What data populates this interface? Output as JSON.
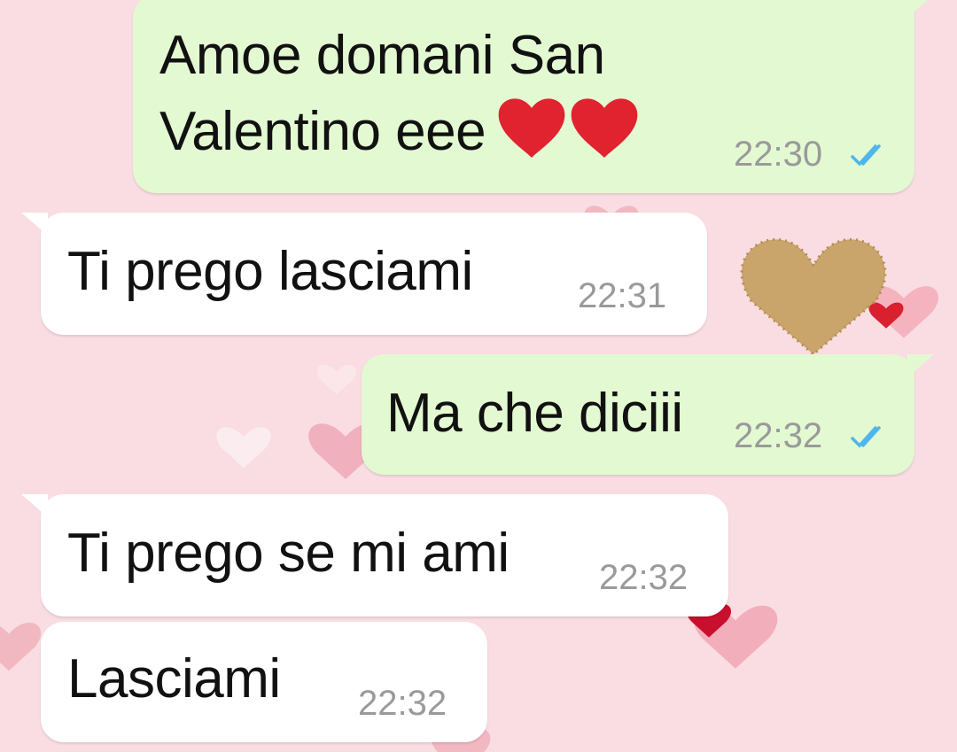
{
  "messages": [
    {
      "direction": "outgoing",
      "text_line1": "Amoe domani San",
      "text_line2": "Valentino eee",
      "emoji_icons": [
        "red-heart-icon",
        "red-heart-icon"
      ],
      "time": "22:30",
      "status": "read"
    },
    {
      "direction": "incoming",
      "text": "Ti prego lasciami",
      "time": "22:31"
    },
    {
      "direction": "outgoing",
      "text": "Ma che diciii",
      "time": "22:32",
      "status": "read"
    },
    {
      "direction": "incoming",
      "text": "Ti prego se mi ami",
      "time": "22:32"
    },
    {
      "direction": "incoming",
      "text": "Lasciami",
      "time": "22:32"
    }
  ],
  "colors": {
    "outgoing_bubble": "#e3f9d2",
    "incoming_bubble": "#ffffff",
    "read_ticks": "#4fb6ec",
    "wallpaper": "#f9dde2"
  }
}
